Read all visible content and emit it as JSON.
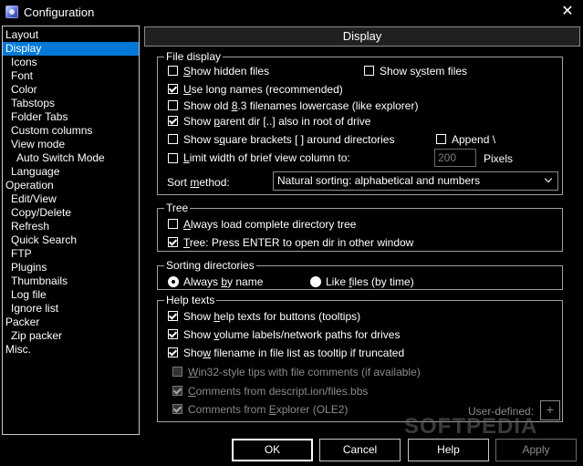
{
  "window": {
    "title": "Configuration",
    "close": "✕"
  },
  "tree": {
    "items": [
      {
        "label": "Layout",
        "indent": 1
      },
      {
        "label": "Display",
        "indent": 1,
        "selected": true
      },
      {
        "label": "Icons",
        "indent": 2
      },
      {
        "label": "Font",
        "indent": 2
      },
      {
        "label": "Color",
        "indent": 2
      },
      {
        "label": "Tabstops",
        "indent": 2
      },
      {
        "label": "Folder Tabs",
        "indent": 2
      },
      {
        "label": "Custom columns",
        "indent": 2
      },
      {
        "label": "View mode",
        "indent": 2
      },
      {
        "label": "Auto Switch Mode",
        "indent": 3
      },
      {
        "label": "Language",
        "indent": 2
      },
      {
        "label": "Operation",
        "indent": 1
      },
      {
        "label": "Edit/View",
        "indent": 2
      },
      {
        "label": "Copy/Delete",
        "indent": 2
      },
      {
        "label": "Refresh",
        "indent": 2
      },
      {
        "label": "Quick Search",
        "indent": 2
      },
      {
        "label": "FTP",
        "indent": 2
      },
      {
        "label": "Plugins",
        "indent": 2
      },
      {
        "label": "Thumbnails",
        "indent": 2
      },
      {
        "label": "Log file",
        "indent": 2
      },
      {
        "label": "Ignore list",
        "indent": 2
      },
      {
        "label": "Packer",
        "indent": 1
      },
      {
        "label": "Zip packer",
        "indent": 2
      },
      {
        "label": "Misc.",
        "indent": 1
      }
    ]
  },
  "panel": {
    "header": "Display"
  },
  "file_display": {
    "title": "File display",
    "show_hidden": {
      "pre": "",
      "u": "S",
      "post": "how hidden files",
      "checked": false
    },
    "show_system": {
      "pre": "Show s",
      "u": "y",
      "post": "stem files",
      "checked": false
    },
    "long_names": {
      "pre": "",
      "u": "U",
      "post": "se long names (recommended)",
      "checked": true
    },
    "old_83": {
      "pre": "Show old ",
      "u": "8",
      "post": ".3 filenames lowercase (like explorer)",
      "checked": false
    },
    "parent_dir": {
      "pre": "Show ",
      "u": "p",
      "post": "arent dir [..] also in root of drive",
      "checked": true
    },
    "square_brackets": {
      "pre": "Show s",
      "u": "q",
      "post": "uare brackets [ ] around directories",
      "checked": false
    },
    "append": {
      "pre": "Append \\",
      "u": "",
      "post": "",
      "checked": false
    },
    "limit_width": {
      "pre": "",
      "u": "L",
      "post": "imit width of brief view column to:",
      "checked": false
    },
    "width_value": "200",
    "pixels": "Pixels",
    "sort_label_pre": "Sort ",
    "sort_label_u": "m",
    "sort_label_post": "ethod:",
    "sort_value": "Natural sorting: alphabetical and numbers"
  },
  "tree_group": {
    "title": "Tree",
    "always_load": {
      "pre": "",
      "u": "A",
      "post": "lways load complete directory tree",
      "checked": false
    },
    "enter_open": {
      "pre": "",
      "u": "T",
      "post": "ree: Press ENTER to open dir in other window",
      "checked": true
    }
  },
  "sorting": {
    "title": "Sorting directories",
    "by_name": {
      "pre": "Always ",
      "u": "b",
      "post": "y name",
      "on": true
    },
    "like_files": {
      "pre": "Like ",
      "u": "f",
      "post": "iles (by time)",
      "on": false
    }
  },
  "help": {
    "title": "Help texts",
    "tooltips": {
      "pre": "Show ",
      "u": "h",
      "post": "elp texts for buttons (tooltips)",
      "checked": true
    },
    "volume_labels": {
      "pre": "Show ",
      "u": "v",
      "post": "olume labels/network paths for drives",
      "checked": true
    },
    "filename_tip": {
      "pre": "Sho",
      "u": "w",
      "post": " filename in file list as tooltip if truncated",
      "checked": true
    },
    "win32_tips": {
      "pre": "",
      "u": "W",
      "post": "in32-style tips with file comments (if available)",
      "checked": false
    },
    "descript": {
      "pre": "",
      "u": "C",
      "post": "omments from descript.ion/files.bbs",
      "checked": true
    },
    "explorer": {
      "pre": "Comments from ",
      "u": "E",
      "post": "xplorer (OLE2)",
      "checked": true
    },
    "user_defined": "User-defined:",
    "plus": "+"
  },
  "buttons": {
    "ok": "OK",
    "cancel": "Cancel",
    "help": "Help",
    "apply": "Apply"
  },
  "watermark": "SOFTPEDIA"
}
